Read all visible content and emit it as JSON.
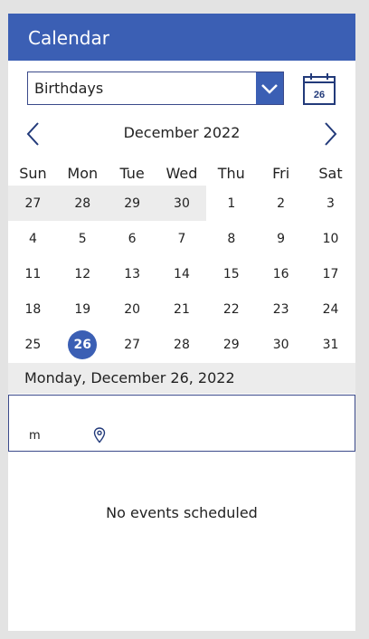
{
  "header": {
    "title": "Calendar"
  },
  "selector": {
    "value": "Birthdays",
    "icon": "chevron-down-icon"
  },
  "calendar_icon": {
    "day": "26"
  },
  "calendar": {
    "month_label": "December 2022",
    "weekdays": [
      "Sun",
      "Mon",
      "Tue",
      "Wed",
      "Thu",
      "Fri",
      "Sat"
    ],
    "weeks": [
      [
        "27",
        "28",
        "29",
        "30",
        "1",
        "2",
        "3"
      ],
      [
        "4",
        "5",
        "6",
        "7",
        "8",
        "9",
        "10"
      ],
      [
        "11",
        "12",
        "13",
        "14",
        "15",
        "16",
        "17"
      ],
      [
        "18",
        "19",
        "20",
        "21",
        "22",
        "23",
        "24"
      ],
      [
        "25",
        "26",
        "27",
        "28",
        "29",
        "30",
        "31"
      ]
    ],
    "selected_day": "26",
    "accent": "#3b5fb4"
  },
  "selected_date": {
    "label": "Monday, December 26, 2022"
  },
  "event": {
    "text": "m",
    "icon": "location-pin-icon"
  },
  "empty_state": {
    "text": "No events scheduled"
  }
}
